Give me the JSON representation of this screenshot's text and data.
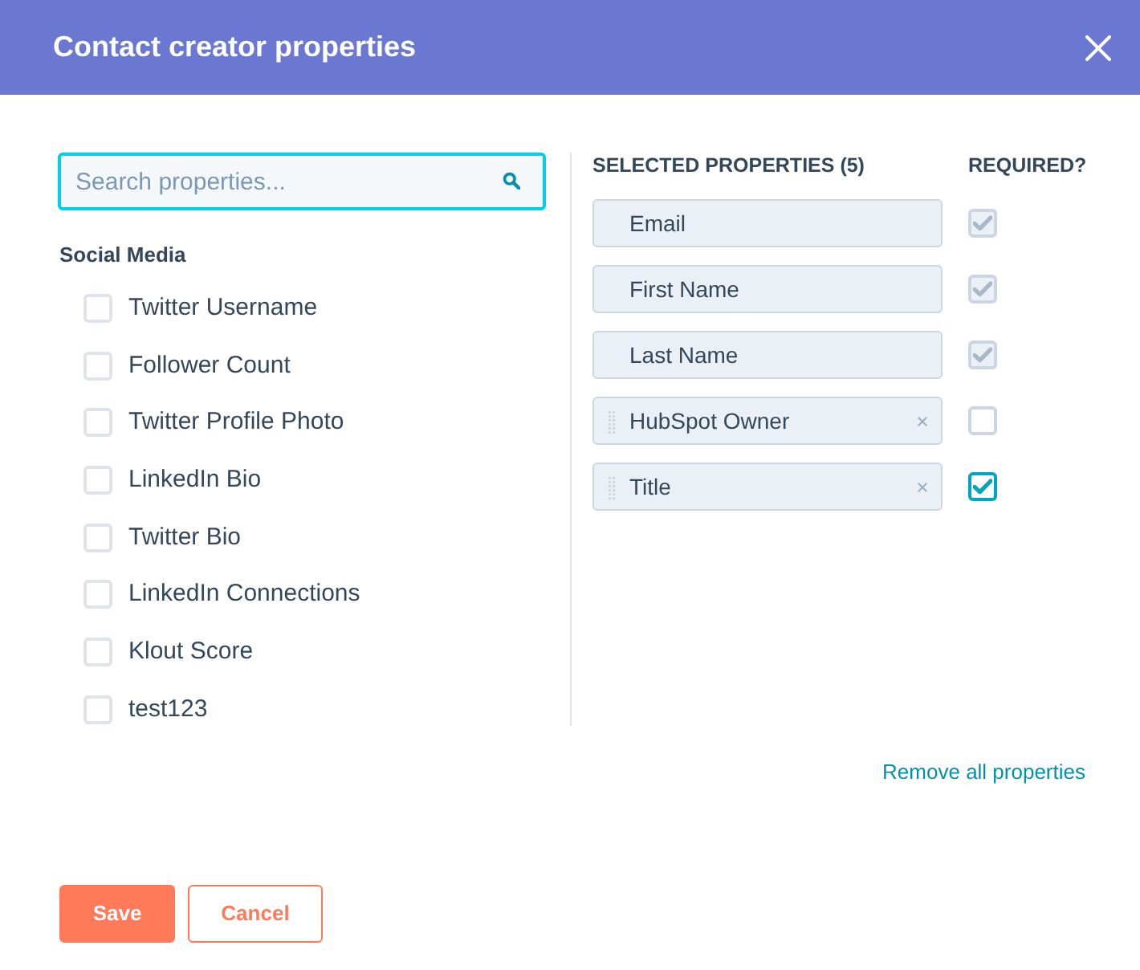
{
  "dialog": {
    "title": "Contact creator properties"
  },
  "search": {
    "placeholder": "Search properties..."
  },
  "groups": [
    {
      "label": "Social Media",
      "items": [
        {
          "label": "Twitter Username",
          "checked": false
        },
        {
          "label": "Follower Count",
          "checked": false
        },
        {
          "label": "Twitter Profile Photo",
          "checked": false
        },
        {
          "label": "LinkedIn Bio",
          "checked": false
        },
        {
          "label": "Twitter Bio",
          "checked": false
        },
        {
          "label": "LinkedIn Connections",
          "checked": false
        },
        {
          "label": "Klout Score",
          "checked": false
        },
        {
          "label": "test123",
          "checked": false
        }
      ]
    }
  ],
  "selected": {
    "heading": "SELECTED PROPERTIES (5)",
    "required_heading": "REQUIRED?",
    "items": [
      {
        "label": "Email",
        "removable": false,
        "required": true,
        "disabled": true
      },
      {
        "label": "First Name",
        "removable": false,
        "required": true,
        "disabled": true
      },
      {
        "label": "Last Name",
        "removable": false,
        "required": true,
        "disabled": true
      },
      {
        "label": "HubSpot Owner",
        "removable": true,
        "required": false,
        "disabled": false
      },
      {
        "label": "Title",
        "removable": true,
        "required": true,
        "disabled": false
      }
    ]
  },
  "remove_all": {
    "label": "Remove all properties"
  },
  "buttons": [
    {
      "label": "Save",
      "kind": "primary"
    },
    {
      "label": "Cancel",
      "kind": "secondary"
    }
  ]
}
